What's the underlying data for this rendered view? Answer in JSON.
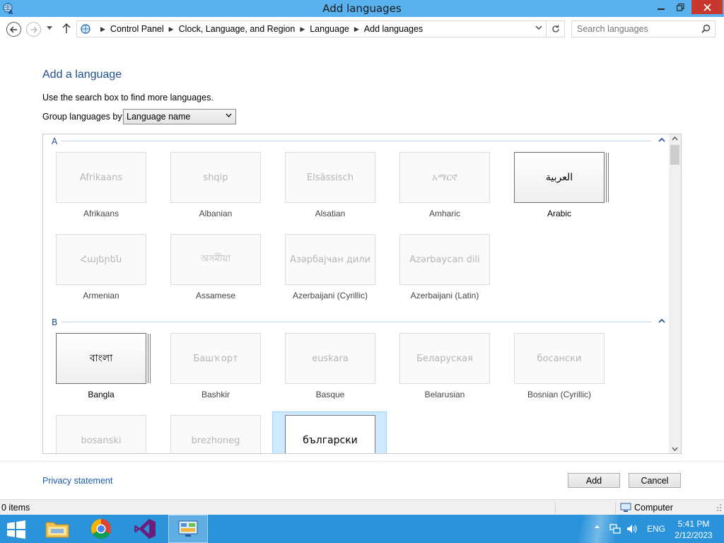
{
  "window": {
    "title": "Add languages"
  },
  "address": {
    "crumbs": [
      "Control Panel",
      "Clock, Language, and Region",
      "Language",
      "Add languages"
    ],
    "search_placeholder": "Search languages"
  },
  "content": {
    "heading": "Add a language",
    "description": "Use the search box to find more languages.",
    "group_label": "Group languages by:",
    "group_value": "Language name"
  },
  "sections": [
    {
      "letter": "A",
      "languages": [
        {
          "native": "Afrikaans",
          "name": "Afrikaans",
          "installed": false
        },
        {
          "native": "shqip",
          "name": "Albanian",
          "installed": false
        },
        {
          "native": "Elsässisch",
          "name": "Alsatian",
          "installed": false
        },
        {
          "native": "አማርኛ",
          "name": "Amharic",
          "installed": false
        },
        {
          "native": "العربية",
          "name": "Arabic",
          "installed": true
        },
        {
          "native": "Հայերեն",
          "name": "Armenian",
          "installed": false
        },
        {
          "native": "অসমীয়া",
          "name": "Assamese",
          "installed": false
        },
        {
          "native": "Азәрбајҹан дили",
          "name": "Azerbaijani (Cyrillic)",
          "installed": false
        },
        {
          "native": "Azərbaycan dili",
          "name": "Azerbaijani (Latin)",
          "installed": false
        }
      ]
    },
    {
      "letter": "B",
      "languages": [
        {
          "native": "বাংলা",
          "name": "Bangla",
          "installed": true
        },
        {
          "native": "Башҡорт",
          "name": "Bashkir",
          "installed": false
        },
        {
          "native": "euskara",
          "name": "Basque",
          "installed": false
        },
        {
          "native": "Беларуская",
          "name": "Belarusian",
          "installed": false
        },
        {
          "native": "босански",
          "name": "Bosnian (Cyrillic)",
          "installed": false
        },
        {
          "native": "bosanski",
          "name": "",
          "installed": false
        },
        {
          "native": "brezhoneg",
          "name": "",
          "installed": false
        },
        {
          "native": "български",
          "name": "",
          "installed": false,
          "selected": true
        }
      ]
    }
  ],
  "footer": {
    "privacy": "Privacy statement",
    "add_label": "Add",
    "cancel_label": "Cancel"
  },
  "status": {
    "items": "0 items",
    "zone": "Computer"
  },
  "taskbar": {
    "lang": "ENG",
    "time": "5:41 PM",
    "date": "2/12/2023"
  },
  "colors": {
    "titlebar": "#59b2ee",
    "close": "#c7372e",
    "link": "#1e5aa8",
    "heading": "#1e4e8f",
    "taskbar": "#2a93da",
    "selection": "#cde8ff"
  }
}
